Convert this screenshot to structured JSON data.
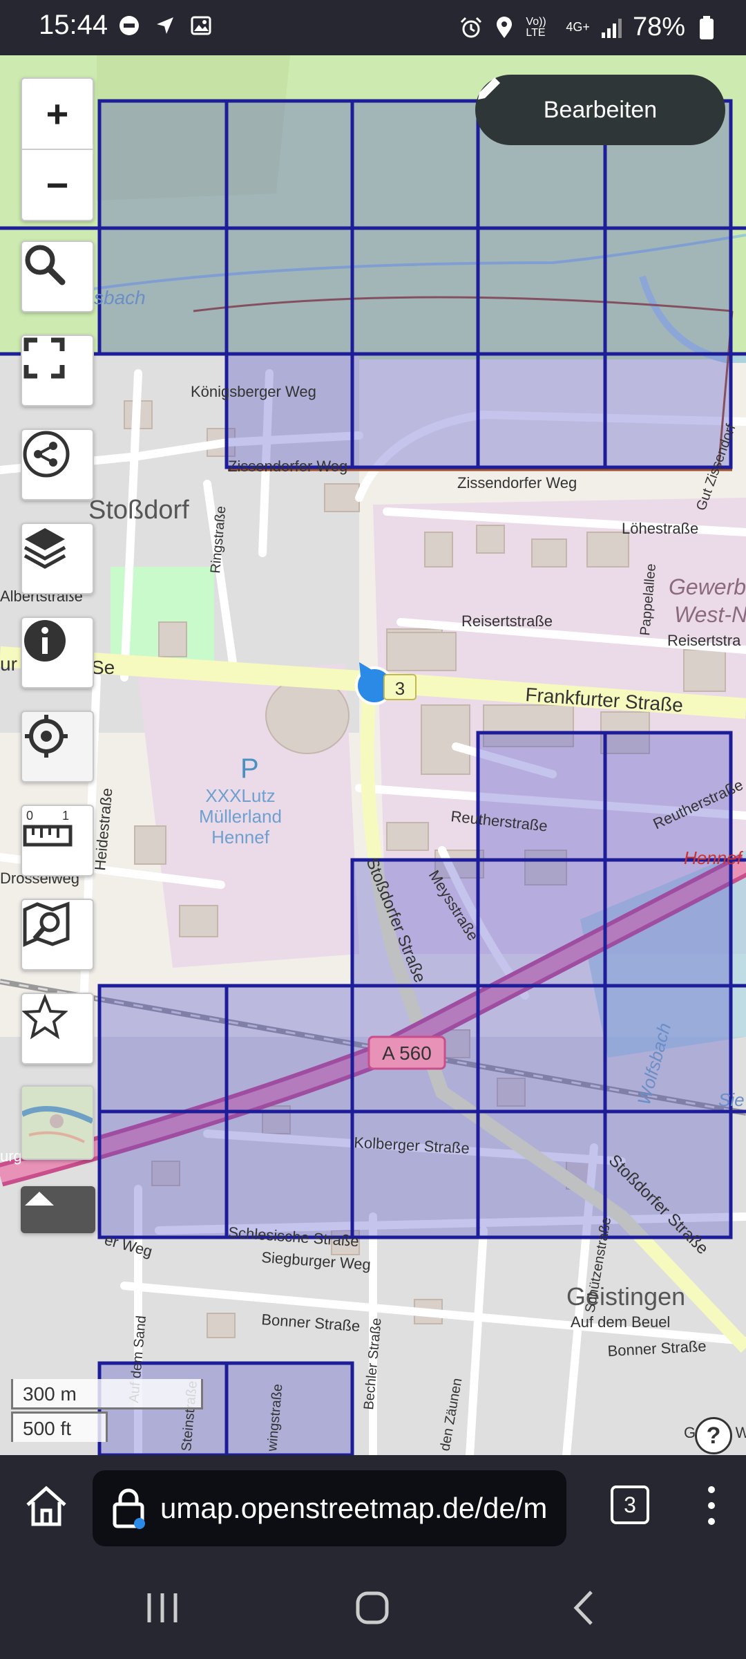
{
  "status_bar": {
    "time": "15:44",
    "network_text": "4G+",
    "volte_text": "Vo)) LTE",
    "battery": "78%"
  },
  "map_controls": {
    "zoom_in": "+",
    "zoom_out": "−",
    "edit_label": "Bearbeiten",
    "scale_metric": "300 m",
    "scale_imperial": "500 ft",
    "help": "?"
  },
  "map_labels": {
    "locality_1": "Stoßdorf",
    "locality_2": "Geistingen",
    "area_1": "Gewerb",
    "area_1b": "West-N",
    "poi_parking": "P",
    "poi_store_1": "XXXLutz",
    "poi_store_2": "Müllerland",
    "poi_store_3": "Hennef",
    "motorway": "A 560",
    "route_ref": "3",
    "river": "sbach",
    "river_2": "Wolfsbach",
    "river_3": "Hennef",
    "river_4": "Sie",
    "streets": {
      "koenigsberger": "Königsberger Weg",
      "zissendorfer_1": "Zissendorfer Weg",
      "zissendorfer_2": "Zissendorfer Weg",
      "gut_zissendorf": "Gut Zissendorf",
      "loehestrasse": "Löhestraße",
      "pappelallee": "Pappelallee",
      "ringstrasse": "Ringstraße",
      "albertstrasse": "Albertstraße",
      "reisertstrasse_1": "Reisertstraße",
      "reisertstrasse_2": "Reisertstra",
      "frankfurter": "Frankfurter Straße",
      "frankfurter_left": "ur",
      "frankfurter_left2": "Se",
      "heidestrasse": "Heidestraße",
      "drosselweg": "Drosselweg",
      "reutherstrasse_1": "Reutherstraße",
      "reutherstrasse_2": "Reutherstraße",
      "meysstrasse": "Meysstraße",
      "stossdorfer_1": "Stoßdorfer Straße",
      "stossdorfer_2": "Stoßdorfer Straße",
      "kolberger": "Kolberger Straße",
      "schuetzenstrasse": "Schützenstraße",
      "schlesische": "Schlesische Straße",
      "siegburger": "Siegburger Weg",
      "bonner_1": "Bonner Straße",
      "bonner_2": "Bonner Straße",
      "auf_dem_beuel": "Auf dem Beuel",
      "auf_dem_sand": "Auf dem Sand",
      "zaeunen": "den Zäunen",
      "bechler": "Bechler Straße",
      "weg_left": "er Weg",
      "burg": "urg",
      "gruener": "Grüner Weg",
      "wingstrasse": "wingstraße",
      "steinstrasse": "Steinstraße"
    }
  },
  "browser": {
    "url": "umap.openstreetmap.de/de/m",
    "tab_count": "3"
  }
}
